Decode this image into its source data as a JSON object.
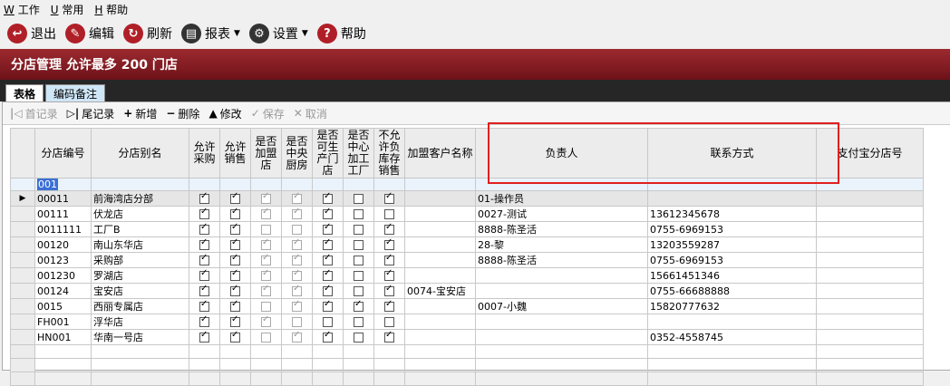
{
  "menu": [
    {
      "key": "W",
      "label": "工作"
    },
    {
      "key": "U",
      "label": "常用"
    },
    {
      "key": "H",
      "label": "帮助"
    }
  ],
  "toolbar": [
    {
      "label": "退出",
      "icon": "exit-icon"
    },
    {
      "label": "编辑",
      "icon": "edit-icon"
    },
    {
      "label": "刷新",
      "icon": "refresh-icon"
    },
    {
      "label": "报表",
      "icon": "print-icon"
    },
    {
      "label": "设置",
      "icon": "settings-icon"
    },
    {
      "label": "帮助",
      "icon": "help-icon"
    }
  ],
  "title": "分店管理  允许最多  200  门店",
  "tabs": [
    "表格",
    "编码备注"
  ],
  "nav": {
    "first": "首记录",
    "last": "尾记录",
    "add": "新增",
    "delete": "删除",
    "edit": "修改",
    "save": "保存",
    "cancel": "取消"
  },
  "columns": [
    "分店编号",
    "分店别名",
    "允许采购",
    "允许销售",
    "是否加盟店",
    "是否中央厨房",
    "是否可生产门店",
    "是否中心加工工厂",
    "不允许负库存销售",
    "加盟客户名称",
    "负责人",
    "联系方式",
    "支付宝分店号"
  ],
  "filter_value": "001",
  "rows": [
    {
      "code": "00011",
      "name": "前海湾店分部",
      "c": [
        1,
        1,
        1,
        1,
        1,
        0,
        1
      ],
      "franchise": "",
      "manager": "01-操作员",
      "phone": "",
      "current": true
    },
    {
      "code": "00111",
      "name": "伏龙店",
      "c": [
        1,
        1,
        1,
        1,
        1,
        0,
        0
      ],
      "franchise": "",
      "manager": "0027-测试",
      "phone": "13612345678"
    },
    {
      "code": "0011111",
      "name": "工厂B",
      "c": [
        1,
        1,
        0,
        0,
        1,
        0,
        1
      ],
      "franchise": "",
      "manager": "8888-陈圣活",
      "phone": "0755-6969153"
    },
    {
      "code": "00120",
      "name": "南山东华店",
      "c": [
        1,
        1,
        1,
        1,
        1,
        0,
        1
      ],
      "franchise": "",
      "manager": "28-黎",
      "phone": "13203559287"
    },
    {
      "code": "00123",
      "name": "采购部",
      "c": [
        1,
        1,
        1,
        1,
        1,
        0,
        1
      ],
      "franchise": "",
      "manager": "8888-陈圣活",
      "phone": "0755-6969153"
    },
    {
      "code": "001230",
      "name": "罗湖店",
      "c": [
        1,
        1,
        1,
        1,
        1,
        0,
        1
      ],
      "franchise": "",
      "manager": "",
      "phone": "15661451346"
    },
    {
      "code": "00124",
      "name": "宝安店",
      "c": [
        1,
        1,
        1,
        1,
        1,
        0,
        1
      ],
      "franchise": "0074-宝安店",
      "manager": "",
      "phone": "0755-66688888"
    },
    {
      "code": "0015",
      "name": "西丽专属店",
      "c": [
        1,
        1,
        0,
        1,
        1,
        1,
        1
      ],
      "franchise": "",
      "manager": "0007-小魏",
      "phone": "15820777632"
    },
    {
      "code": "FH001",
      "name": "浮华店",
      "c": [
        1,
        1,
        1,
        0,
        0,
        0,
        0
      ],
      "franchise": "",
      "manager": "",
      "phone": ""
    },
    {
      "code": "HN001",
      "name": "华南一号店",
      "c": [
        1,
        1,
        0,
        1,
        1,
        0,
        1
      ],
      "franchise": "",
      "manager": "",
      "phone": "0352-4558745"
    }
  ]
}
